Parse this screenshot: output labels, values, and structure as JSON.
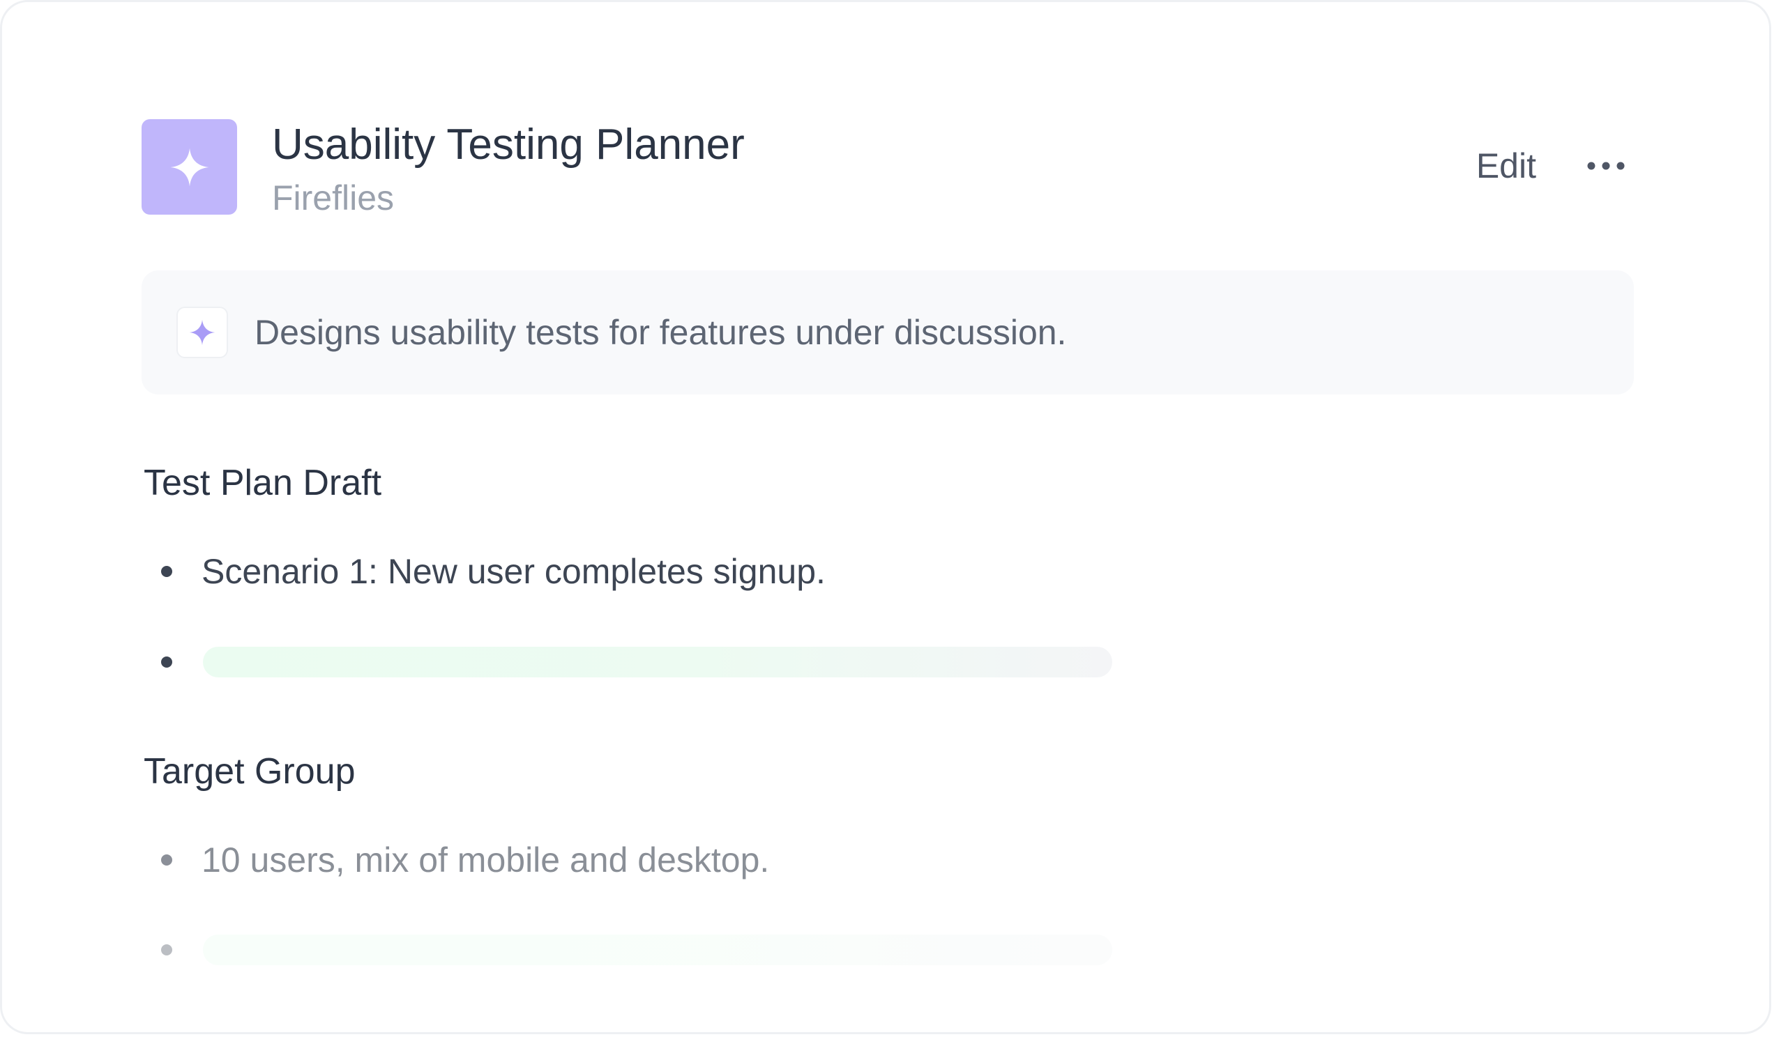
{
  "header": {
    "title": "Usability Testing Planner",
    "subtitle": "Fireflies",
    "edit_label": "Edit",
    "app_icon": "sparkle-icon",
    "more_icon": "more-horizontal-icon"
  },
  "description": {
    "icon": "sparkle-icon",
    "text": "Designs usability tests for features under discussion."
  },
  "sections": [
    {
      "title": "Test Plan Draft",
      "items": [
        "Scenario 1: New user completes signup."
      ]
    },
    {
      "title": "Target Group",
      "items": [
        "10 users, mix of mobile and desktop."
      ]
    }
  ],
  "colors": {
    "accent": "#c0b6fb",
    "accent_icon": "#a99cf6",
    "title_text": "#2b3444",
    "muted_text": "#9aa1ad",
    "skeleton": "#edfbf2"
  }
}
